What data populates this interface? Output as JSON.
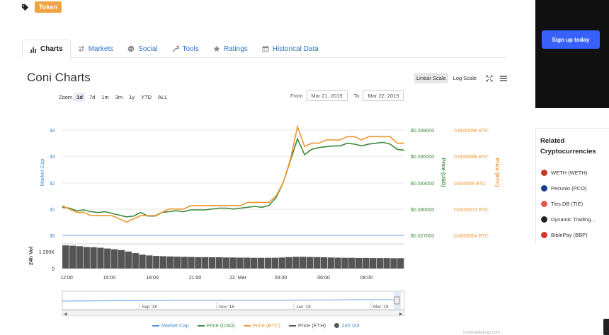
{
  "tag": {
    "label": "Token"
  },
  "tabs": [
    {
      "label": "Charts",
      "icon": "bar-chart-icon",
      "active": true
    },
    {
      "label": "Markets",
      "icon": "exchange-arrows-icon"
    },
    {
      "label": "Social",
      "icon": "globe-icon"
    },
    {
      "label": "Tools",
      "icon": "wrench-icon"
    },
    {
      "label": "Ratings",
      "icon": "star-icon"
    },
    {
      "label": "Historical Data",
      "icon": "calendar-icon"
    }
  ],
  "chart_header": {
    "title": "Coni Charts",
    "linear_scale": "Linear Scale",
    "log_scale": "Log Scale"
  },
  "zoom": {
    "label": "Zoom",
    "options": [
      "1d",
      "7d",
      "1m",
      "3m",
      "1y",
      "YTD",
      "ALL"
    ],
    "selected": "1d"
  },
  "range": {
    "from_label": "From",
    "from": "Mar 21, 2019",
    "to_label": "To",
    "to": "Mar 22, 2019"
  },
  "chart_data": {
    "type": "line",
    "x_ticks": [
      "12:00",
      "15:00",
      "18:00",
      "21:00",
      "22. Mar",
      "03:00",
      "06:00",
      "09:00"
    ],
    "navigator_ticks": [
      "Sep '18",
      "Nov '18",
      "Jan '19",
      "Mar '19"
    ],
    "left_axis": {
      "label": "Market Cap",
      "ticks": [
        "$4",
        "$3",
        "$2",
        "$1",
        "$0"
      ]
    },
    "usd_axis": {
      "label": "Price (USD)",
      "ticks": [
        "$0.039000",
        "$0.036000",
        "$0.033000",
        "$0.030000",
        "$0.027000"
      ]
    },
    "btc_axis": {
      "label": "Price (BTC)",
      "ticks": [
        "0.0000096 BTC",
        "0.0000088 BTC",
        "0.000008 BTC",
        "0.0000072 BTC",
        "0.0000064 BTC"
      ]
    },
    "volume_axis": {
      "label": "24h Vol",
      "ticks": [
        "1 200K",
        "0"
      ]
    },
    "market_cap": {
      "value": 0
    },
    "series": [
      {
        "name": "Price (USD)",
        "color": "#3c8a3c",
        "values": [
          0.0302,
          0.0301,
          0.0298,
          0.0299,
          0.0297,
          0.0296,
          0.0297,
          0.0295,
          0.0293,
          0.0291,
          0.0292,
          0.0296,
          0.0292,
          0.0292,
          0.0296,
          0.0297,
          0.0298,
          0.0297,
          0.0299,
          0.0299,
          0.0299,
          0.03,
          0.0301,
          0.0301,
          0.03,
          0.0301,
          0.0302,
          0.0303,
          0.0302,
          0.0304,
          0.0313,
          0.033,
          0.0355,
          0.038,
          0.0362,
          0.0368,
          0.037,
          0.0371,
          0.0372,
          0.0372,
          0.0375,
          0.0374,
          0.0372,
          0.0374,
          0.0375,
          0.0376,
          0.0374,
          0.0368,
          0.0367
        ]
      },
      {
        "name": "Price (BTC)",
        "color": "#f0952e",
        "values": [
          7.3e-06,
          7.2e-06,
          7.1e-06,
          7.1e-06,
          7e-06,
          7e-06,
          7e-06,
          7e-06,
          6.9e-06,
          6.8e-06,
          6.9e-06,
          7e-06,
          7e-06,
          7e-06,
          7.1e-06,
          7.2e-06,
          7.2e-06,
          7.2e-06,
          7.3e-06,
          7.3e-06,
          7.3e-06,
          7.3e-06,
          7.3e-06,
          7.3e-06,
          7.3e-06,
          7.3e-06,
          7.4e-06,
          7.4e-06,
          7.4e-06,
          7.4e-06,
          7.6e-06,
          8e-06,
          8.7e-06,
          9.7e-06,
          9.1e-06,
          9.2e-06,
          9.2e-06,
          9.3e-06,
          9.3e-06,
          9.3e-06,
          9.4e-06,
          9.4e-06,
          9.3e-06,
          9.4e-06,
          9.4e-06,
          9.4e-06,
          9.4e-06,
          9.2e-06,
          9.2e-06
        ]
      },
      {
        "name": "24h Vol",
        "values": [
          1500,
          1480,
          1450,
          1400,
          1380,
          1350,
          1300,
          1250,
          1200,
          1100,
          1000,
          900,
          850,
          820,
          800,
          780,
          770,
          760,
          750,
          740,
          740,
          730,
          730,
          720,
          720,
          710,
          710,
          700,
          700,
          700,
          700,
          720,
          740,
          760,
          760,
          750,
          740,
          730,
          720,
          710,
          700,
          700,
          690,
          690,
          680,
          680,
          680,
          670,
          670
        ]
      }
    ],
    "legend": [
      "Market Cap",
      "Price (USD)",
      "Price (BTC)",
      "Price (ETH)",
      "24h Vol"
    ]
  },
  "sidebar": {
    "signup_label": "Sign up today",
    "related_title": "Related Cryptocurrencies",
    "related": [
      {
        "label": "WETH (WETH)",
        "icon": "weth-icon",
        "color": "#c0392b"
      },
      {
        "label": "Pecunio (PCO)",
        "icon": "pecunio-icon",
        "color": "#1a3f8b"
      },
      {
        "label": "Ties.DB (TIE)",
        "icon": "tiesdb-icon",
        "color": "#e05a4f"
      },
      {
        "label": "Dynamic Trading...",
        "icon": "dynamic-trading-icon",
        "color": "#222222"
      },
      {
        "label": "BiblePay (BBP)",
        "icon": "biblepay-icon",
        "color": "#d9342b"
      }
    ]
  },
  "footer": {
    "watermark": "coinmarketcap.com"
  }
}
